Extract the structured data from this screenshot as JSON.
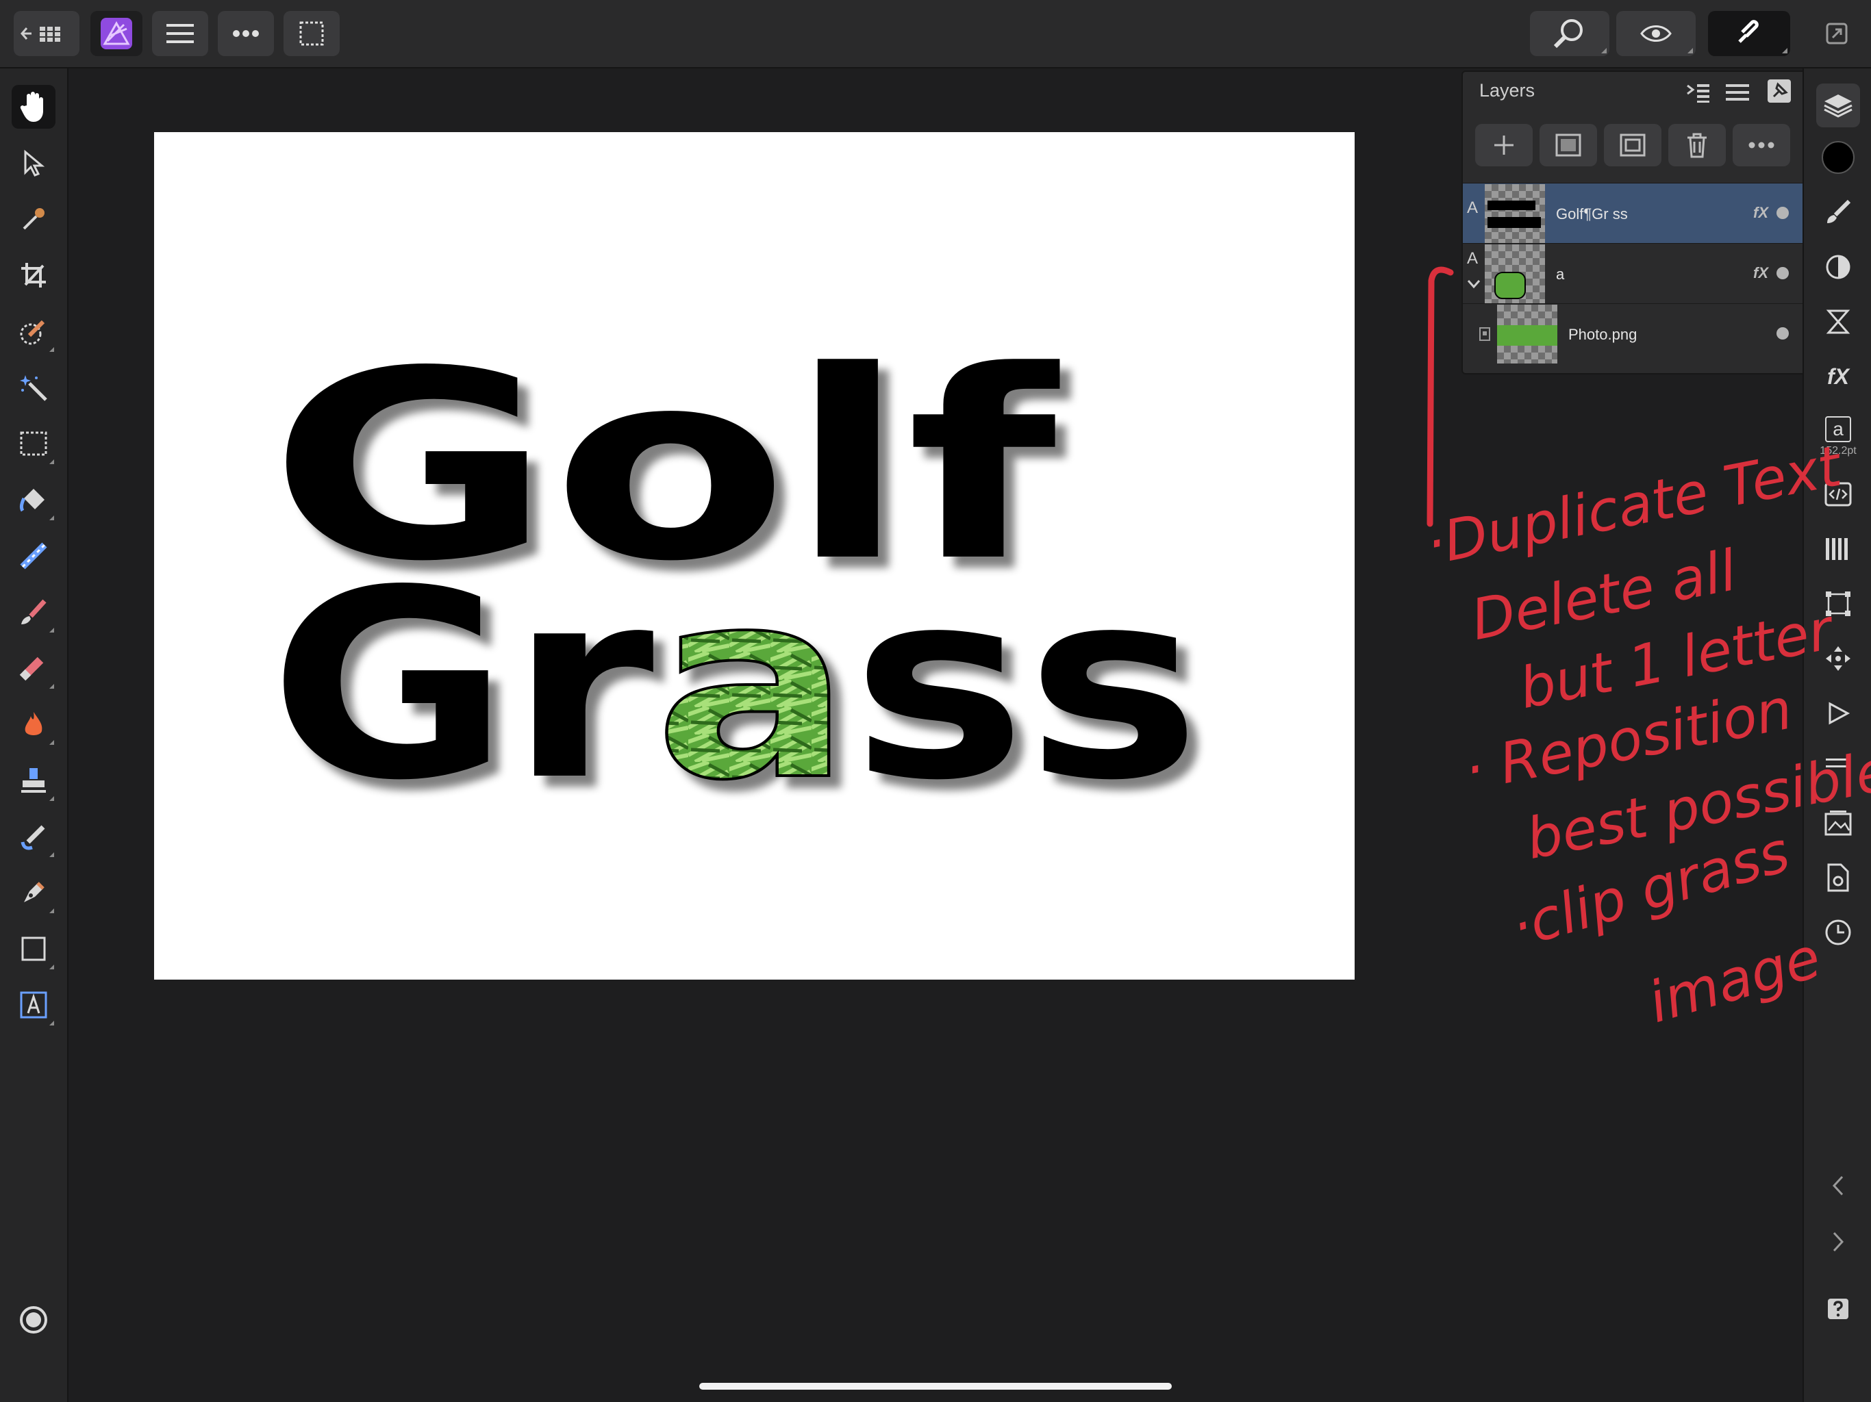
{
  "app": {
    "accent_color": "#8f4be0",
    "canvas_background": "#ffffff"
  },
  "toolbar_top": {
    "icons": [
      "back-arrow-icon",
      "grid-icon",
      "affinity-photo-logo-icon",
      "hamburger-menu-icon",
      "more-dots-icon",
      "selection-marquee-icon",
      "zoom-icon",
      "view-mode-icon",
      "snapping-icon",
      "fullscreen-icon"
    ]
  },
  "left_tools": [
    "hand-tool-icon",
    "move-tool-icon",
    "color-picker-icon",
    "crop-tool-icon",
    "selection-brush-icon",
    "magic-wand-icon",
    "rectangle-marquee-icon",
    "flood-fill-icon",
    "gradient-tool-icon",
    "paint-brush-icon",
    "erase-brush-icon",
    "burn-dodge-icon",
    "clone-stamp-icon",
    "smudge-brush-icon",
    "pen-tool-icon",
    "shape-tool-icon",
    "text-tool-icon"
  ],
  "canvas": {
    "line1": "Golf",
    "line2_prefix": "Gr",
    "line2_highlight": "a",
    "line2_suffix": "ss",
    "grass_color": "#5aa83a"
  },
  "layers_panel": {
    "title": "Layers",
    "rows": [
      {
        "type_badge": "A",
        "name": "Golf¶Gr   ss",
        "fx": "fX",
        "selected": true
      },
      {
        "type_badge": "A",
        "name": "a",
        "fx": "fX",
        "selected": false
      },
      {
        "type_badge": "",
        "name": "Photo.png",
        "fx": "",
        "selected": false
      }
    ],
    "selected_row_color": "#3d5373"
  },
  "right_strip": {
    "text_size": "152.2pt",
    "text_glyph": "a",
    "fx_label": "fX"
  },
  "notes": {
    "color": "#d9303c",
    "lines": [
      "·Duplicate Text",
      "Delete all",
      "but 1 letter",
      "· Reposition",
      "best possible",
      "·clip grass",
      "image"
    ]
  }
}
